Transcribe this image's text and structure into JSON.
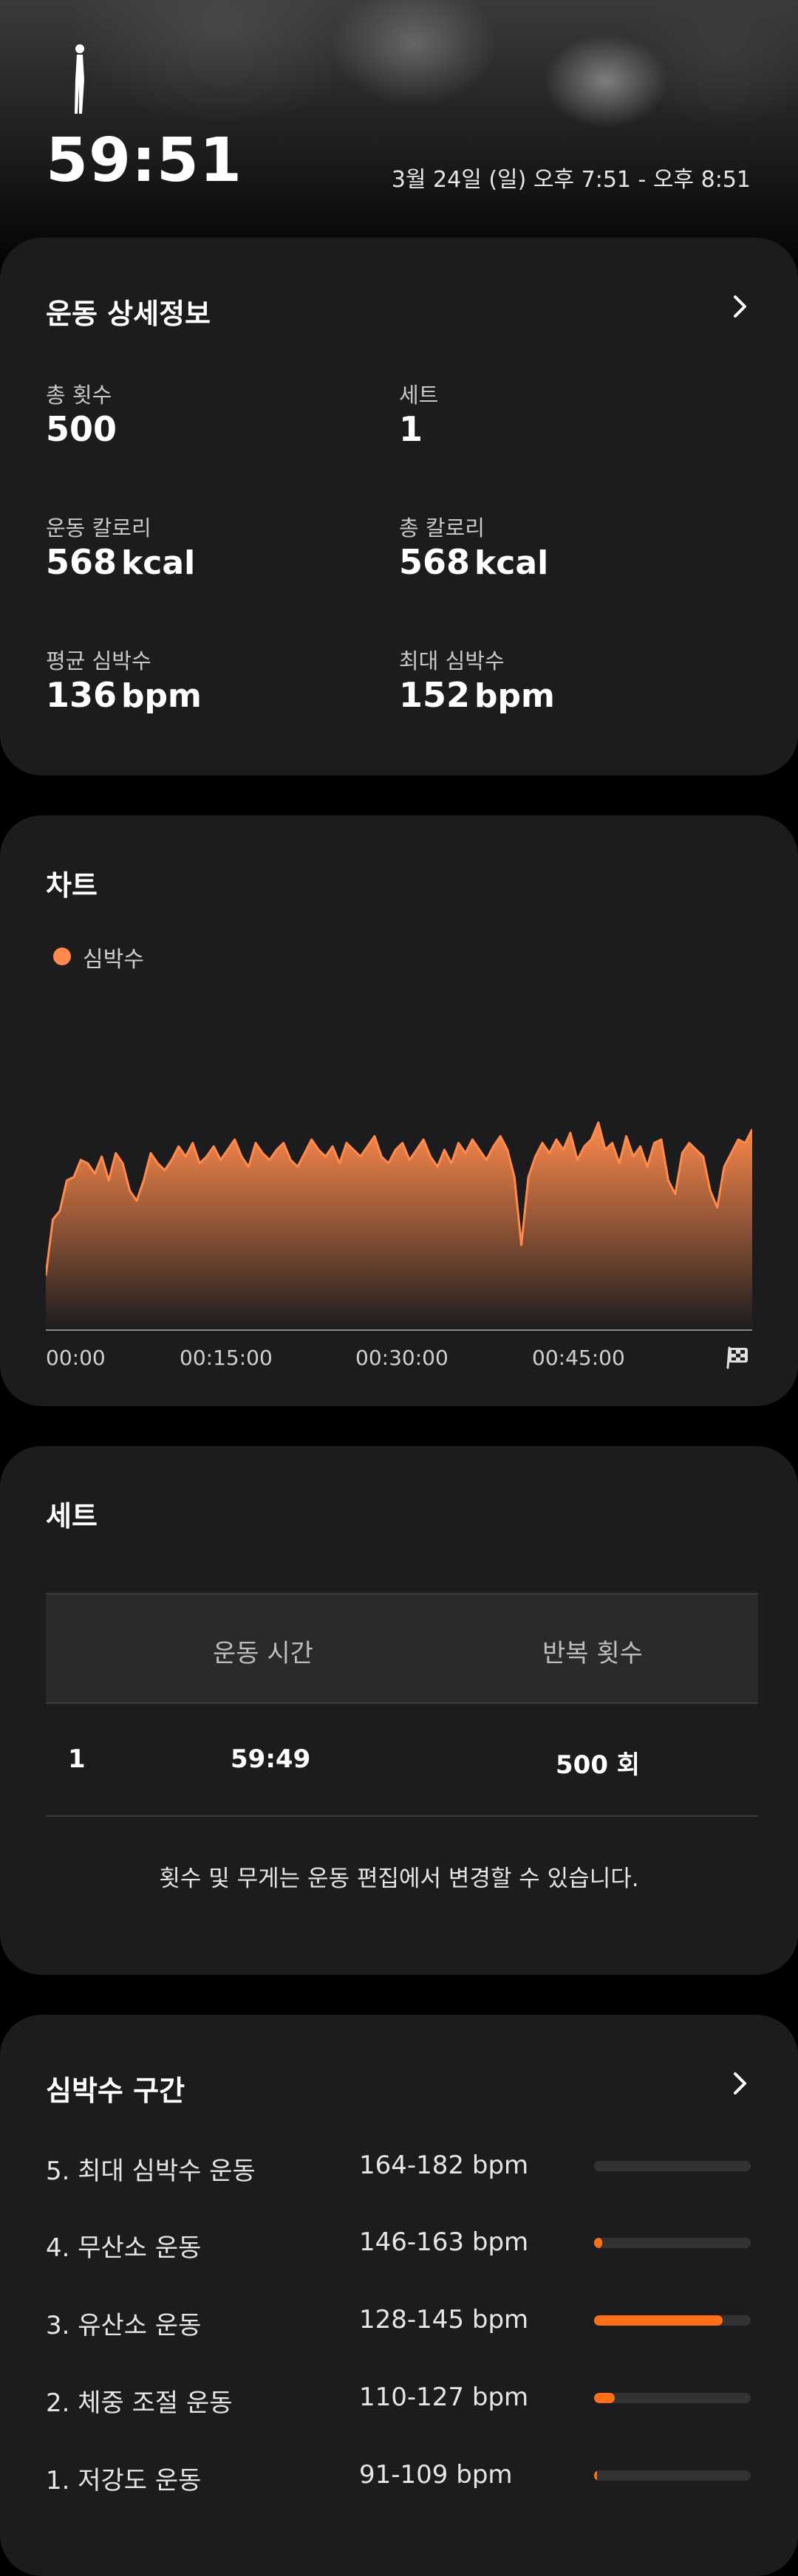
{
  "hero": {
    "duration": "59:51",
    "date_range": "3월 24일 (일) 오후 7:51 - 오후 8:51"
  },
  "details": {
    "title": "운동 상세정보",
    "stats": [
      {
        "label": "총 횟수",
        "value": "500",
        "unit": ""
      },
      {
        "label": "세트",
        "value": "1",
        "unit": ""
      },
      {
        "label": "운동 칼로리",
        "value": "568",
        "unit": "kcal"
      },
      {
        "label": "총 칼로리",
        "value": "568",
        "unit": "kcal"
      },
      {
        "label": "평균 심박수",
        "value": "136",
        "unit": "bpm"
      },
      {
        "label": "최대 심박수",
        "value": "152",
        "unit": "bpm"
      }
    ]
  },
  "chart": {
    "title": "차트",
    "legend": "심박수",
    "color": "#ff8a4c"
  },
  "chart_data": {
    "type": "area",
    "series": [
      {
        "name": "심박수",
        "values": [
          62,
          95,
          100,
          118,
          120,
          130,
          128,
          122,
          132,
          118,
          134,
          128,
          112,
          106,
          118,
          134,
          128,
          124,
          130,
          138,
          132,
          140,
          128,
          132,
          138,
          130,
          136,
          142,
          132,
          126,
          140,
          134,
          130,
          136,
          140,
          130,
          126,
          134,
          142,
          136,
          132,
          138,
          128,
          140,
          136,
          132,
          138,
          144,
          132,
          128,
          136,
          140,
          130,
          136,
          142,
          132,
          126,
          136,
          128,
          140,
          134,
          142,
          136,
          130,
          138,
          144,
          136,
          120,
          80,
          120,
          132,
          140,
          134,
          142,
          136,
          146,
          130,
          138,
          142,
          152,
          136,
          140,
          128,
          144,
          132,
          138,
          126,
          140,
          142,
          118,
          110,
          134,
          140,
          136,
          132,
          112,
          102,
          126,
          134,
          142,
          140,
          148
        ],
        "x_start_sec": 0,
        "x_end_sec": 3591
      }
    ],
    "x_tick_labels": [
      "00:00",
      "00:15:00",
      "00:30:00",
      "00:45:00"
    ],
    "ylim": [
      30,
      165
    ]
  },
  "sets": {
    "title": "세트",
    "headers": [
      "운동 시간",
      "반복 횟수"
    ],
    "rows": [
      {
        "index": "1",
        "time": "59:49",
        "reps": "500 회"
      }
    ],
    "note": "횟수 및 무게는 운동 편집에서 변경할 수 있습니다."
  },
  "zones": {
    "title": "심박수 구간",
    "items": [
      {
        "name": "5. 최대 심박수 운동",
        "range": "164-182 bpm",
        "fraction": 0.0
      },
      {
        "name": "4. 무산소 운동",
        "range": "146-163 bpm",
        "fraction": 0.05
      },
      {
        "name": "3. 유산소 운동",
        "range": "128-145 bpm",
        "fraction": 0.82
      },
      {
        "name": "2. 체중 조절 운동",
        "range": "110-127 bpm",
        "fraction": 0.13
      },
      {
        "name": "1. 저강도 운동",
        "range": "91-109 bpm",
        "fraction": 0.02
      }
    ],
    "accent": "#ff6f1a"
  }
}
